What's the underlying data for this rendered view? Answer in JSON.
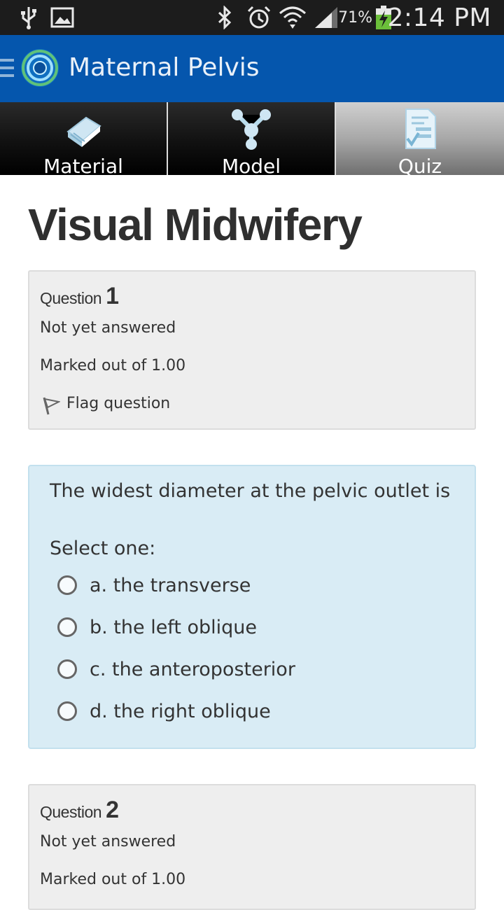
{
  "status_bar": {
    "time": "2:14 PM",
    "battery_percent": "71%",
    "icons": [
      "usb-icon",
      "image-icon",
      "bluetooth-icon",
      "alarm-icon",
      "wifi-icon",
      "signal-icon",
      "battery-charging-icon"
    ]
  },
  "app_bar": {
    "title": "Maternal Pelvis",
    "accent_color": "#0556ad"
  },
  "tabs": [
    {
      "label": "Material",
      "icon": "book-icon",
      "active": false
    },
    {
      "label": "Model",
      "icon": "molecule-icon",
      "active": false
    },
    {
      "label": "Quiz",
      "icon": "quiz-checklist-icon",
      "active": true
    }
  ],
  "page": {
    "title": "Visual Midwifery"
  },
  "questions": [
    {
      "label": "Question",
      "number": "1",
      "status": "Not yet answered",
      "marks": "Marked out of 1.00",
      "flag_label": "Flag question",
      "text": "The widest diameter at the pelvic outlet is",
      "select_label": "Select one:",
      "options": [
        "a. the transverse",
        "b. the left oblique",
        "c. the anteroposterior",
        "d. the right oblique"
      ]
    },
    {
      "label": "Question",
      "number": "2",
      "status": "Not yet answered",
      "marks": "Marked out of 1.00"
    }
  ]
}
